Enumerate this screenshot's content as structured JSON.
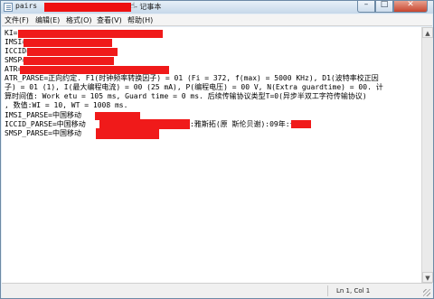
{
  "window": {
    "title_prefix": "pairs",
    "title_suffix": "- 记事本",
    "cursor_glyph": "☝",
    "buttons": {
      "minimize": "–",
      "maximize": "□",
      "close": "✕"
    }
  },
  "menu": [
    "文件(F)",
    "编辑(E)",
    "格式(O)",
    "查看(V)",
    "帮助(H)"
  ],
  "lines": [
    "KI=",
    "IMSI=",
    "ICCID=",
    "SMSP=",
    "ATR=",
    "ATR_PARSE=正向约定. F1(时钟频率转换因子) = 01 (Fi = 372, f(max) = 5000 KHz), D1(波特率校正因",
    "子) = 01 (1), I(最大编程电流) = 00 (25 mA), P(编程电压) = 00 V, N(Extra guardtime) = 00. 计",
    "算时间值: Work etu = 105 ms, Guard time = 0 ms. 后续传输协议类型T=0(异步半双工字符传输协议)",
    ", 数值:WI = 10, WT = 1008 ms.",
    "IMSI_PARSE=中国移动",
    "ICCID_PARSE=中国移动",
    "SMSP_PARSE=中国移动"
  ],
  "iccid_detail": ":雅斯拓(原 斯伦贝谢):09年:号段",
  "status": {
    "position": "Ln 1, Col 1"
  },
  "colors": {
    "redaction": "#f01a1a",
    "title_bar": "#c6d8ea",
    "close_button": "#c7452f"
  }
}
